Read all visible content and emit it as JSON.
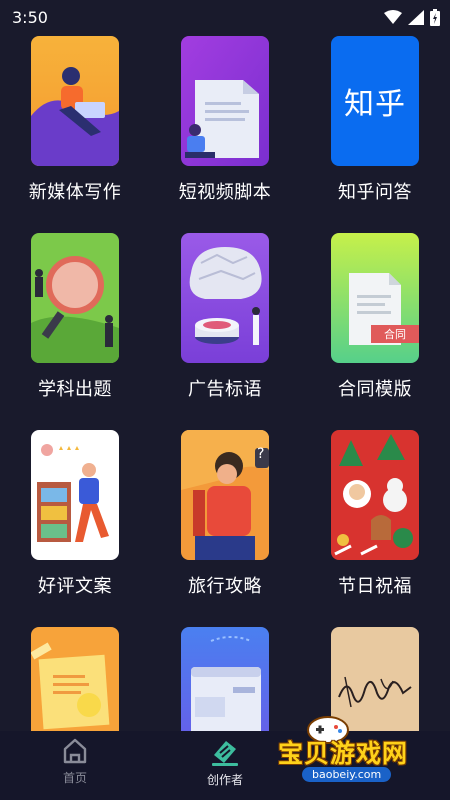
{
  "status_bar": {
    "time": "3:50"
  },
  "tiles": [
    {
      "label": "新媒体写作",
      "image": "person-at-laptop-illustration"
    },
    {
      "label": "短视频脚本",
      "image": "person-with-document-illustration"
    },
    {
      "label": "知乎问答",
      "image": "zhihu-logo",
      "logo_text": "知乎"
    },
    {
      "label": "学科出题",
      "image": "magnifier-illustration"
    },
    {
      "label": "广告标语",
      "image": "brain-lab-illustration"
    },
    {
      "label": "合同模版",
      "image": "contract-document-illustration",
      "badge": "合同"
    },
    {
      "label": "好评文案",
      "image": "review-stars-illustration"
    },
    {
      "label": "旅行攻略",
      "image": "traveler-illustration"
    },
    {
      "label": "节日祝福",
      "image": "christmas-pattern-illustration"
    },
    {
      "label": "",
      "image": "sticky-note-illustration"
    },
    {
      "label": "",
      "image": "browser-window-illustration"
    },
    {
      "label": "",
      "image": "signature-illustration"
    }
  ],
  "tabbar": {
    "tabs": [
      {
        "label": "首页",
        "icon": "home-icon",
        "active": false
      },
      {
        "label": "创作者",
        "icon": "creator-pen-icon",
        "active": true
      }
    ]
  },
  "watermark": {
    "title": "宝贝游戏网",
    "url": "baobeiy.com"
  },
  "colors": {
    "background": "#191a2c",
    "tabbar": "#15162a",
    "active_tab": "#3dbd9e"
  }
}
